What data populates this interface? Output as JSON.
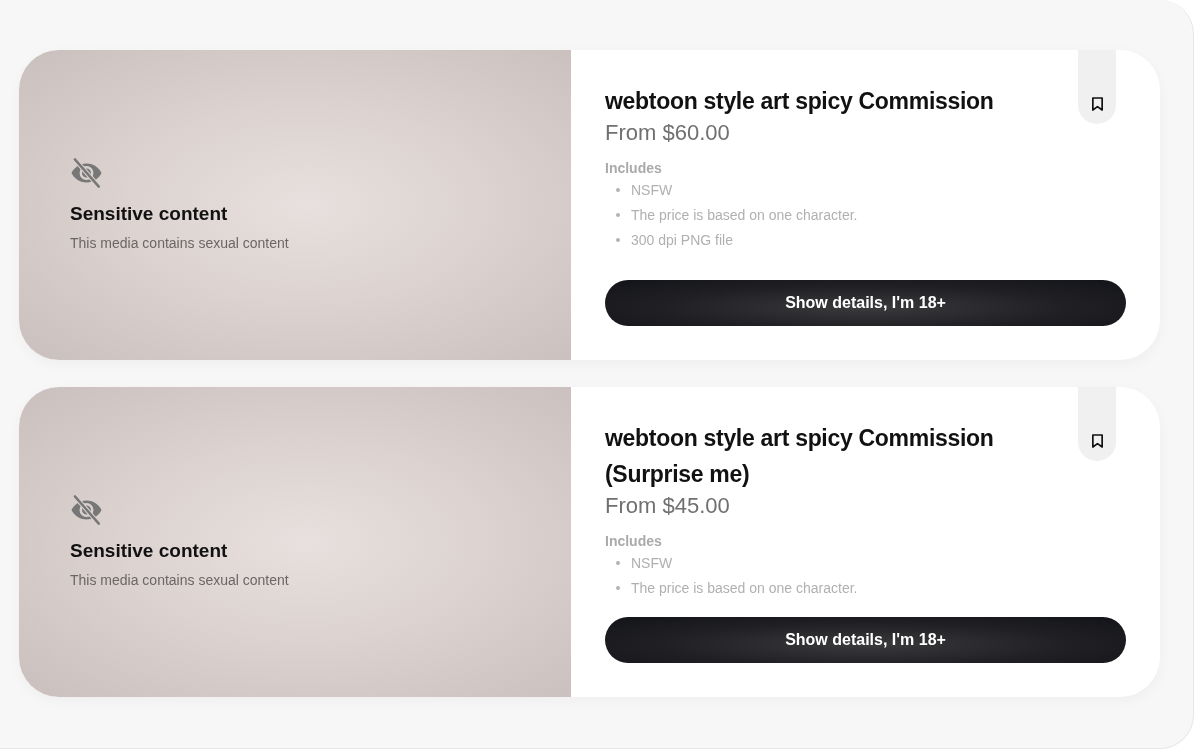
{
  "listings": [
    {
      "media": {
        "title": "Sensitive content",
        "message": "This media contains sexual content"
      },
      "title": "webtoon style art spicy Commission",
      "saved": false,
      "price": "From $60.00",
      "includes_label": "Includes",
      "includes": [
        "NSFW",
        "The price is based on one character.",
        "300 dpi PNG file"
      ],
      "button": "Show details, I'm 18+"
    },
    {
      "media": {
        "title": "Sensitive content",
        "message": "This media contains sexual content"
      },
      "title": "webtoon style art spicy Commission (Surprise me)",
      "saved": false,
      "price": "From $45.00",
      "includes_label": "Includes",
      "includes": [
        "NSFW",
        "The price is based on one character."
      ],
      "button": "Show details, I'm 18+"
    }
  ]
}
